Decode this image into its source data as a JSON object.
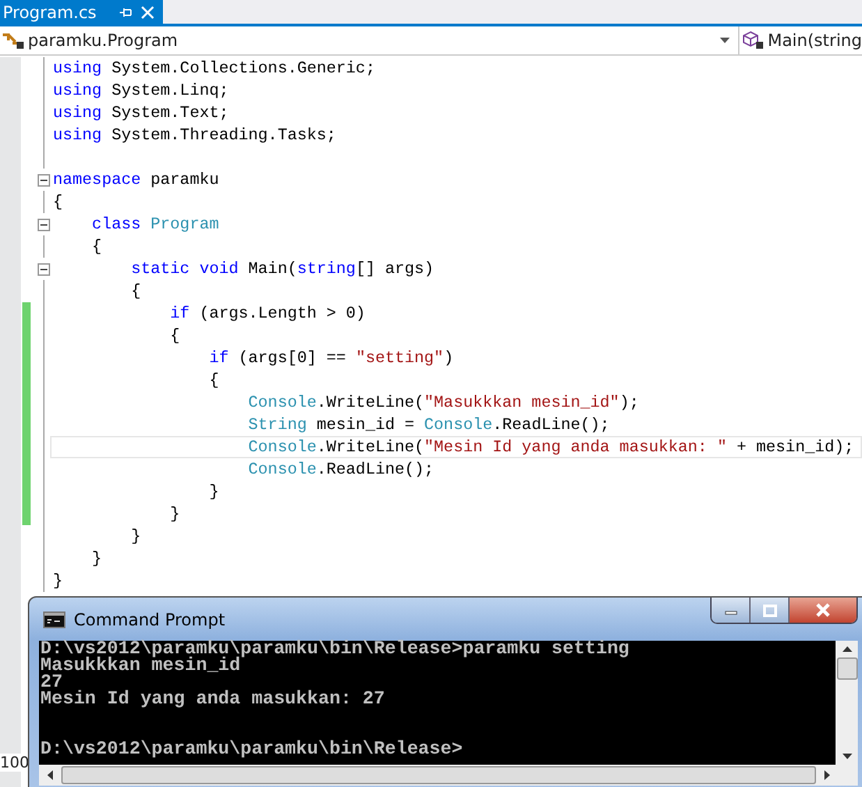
{
  "tab": {
    "title": "Program.cs",
    "selected": true
  },
  "nav": {
    "type_dropdown": "paramku.Program",
    "member_dropdown": "Main(string"
  },
  "code_lines": [
    {
      "tokens": [
        {
          "kind": "keyword",
          "text": "using"
        },
        {
          "kind": "plain",
          "text": " System.Collections.Generic;"
        }
      ],
      "foldable": false,
      "changed": false,
      "current": false
    },
    {
      "tokens": [
        {
          "kind": "keyword",
          "text": "using"
        },
        {
          "kind": "plain",
          "text": " System.Linq;"
        }
      ],
      "foldable": false,
      "changed": false,
      "current": false
    },
    {
      "tokens": [
        {
          "kind": "keyword",
          "text": "using"
        },
        {
          "kind": "plain",
          "text": " System.Text;"
        }
      ],
      "foldable": false,
      "changed": false,
      "current": false
    },
    {
      "tokens": [
        {
          "kind": "keyword",
          "text": "using"
        },
        {
          "kind": "plain",
          "text": " System.Threading.Tasks;"
        }
      ],
      "foldable": false,
      "changed": false,
      "current": false
    },
    {
      "foldable": false,
      "changed": false,
      "current": false
    },
    {
      "tokens": [
        {
          "kind": "keyword",
          "text": "namespace"
        },
        {
          "kind": "plain",
          "text": " paramku"
        }
      ],
      "foldable": true,
      "changed": false,
      "current": false
    },
    {
      "tokens": [
        {
          "kind": "plain",
          "text": "{"
        }
      ],
      "foldable": false,
      "changed": false,
      "current": false
    },
    {
      "tokens": [
        {
          "kind": "keyword",
          "text": "    class"
        },
        {
          "kind": "type",
          "text": " Program"
        }
      ],
      "foldable": true,
      "changed": false,
      "current": false
    },
    {
      "tokens": [
        {
          "kind": "plain",
          "text": "    {"
        }
      ],
      "foldable": false,
      "changed": false,
      "current": false
    },
    {
      "tokens": [
        {
          "kind": "keyword",
          "text": "        static void"
        },
        {
          "kind": "plain",
          "text": " Main("
        },
        {
          "kind": "keyword",
          "text": "string"
        },
        {
          "kind": "plain",
          "text": "[] args)"
        }
      ],
      "foldable": true,
      "changed": false,
      "current": false
    },
    {
      "tokens": [
        {
          "kind": "plain",
          "text": "        {"
        }
      ],
      "foldable": false,
      "changed": false,
      "current": false
    },
    {
      "tokens": [
        {
          "kind": "keyword",
          "text": "            if"
        },
        {
          "kind": "plain",
          "text": " (args.Length > 0)"
        }
      ],
      "foldable": false,
      "changed": true,
      "current": false
    },
    {
      "tokens": [
        {
          "kind": "plain",
          "text": "            {"
        }
      ],
      "foldable": false,
      "changed": true,
      "current": false
    },
    {
      "tokens": [
        {
          "kind": "keyword",
          "text": "                if"
        },
        {
          "kind": "plain",
          "text": " (args[0] == "
        },
        {
          "kind": "string",
          "text": "\"setting\""
        },
        {
          "kind": "plain",
          "text": ")"
        }
      ],
      "foldable": false,
      "changed": true,
      "current": false
    },
    {
      "tokens": [
        {
          "kind": "plain",
          "text": "                {"
        }
      ],
      "foldable": false,
      "changed": true,
      "current": false
    },
    {
      "tokens": [
        {
          "kind": "type",
          "text": "                    Console"
        },
        {
          "kind": "plain",
          "text": ".WriteLine("
        },
        {
          "kind": "string",
          "text": "\"Masukkkan mesin_id\""
        },
        {
          "kind": "plain",
          "text": ");"
        }
      ],
      "foldable": false,
      "changed": true,
      "current": false
    },
    {
      "tokens": [
        {
          "kind": "type",
          "text": "                    String"
        },
        {
          "kind": "plain",
          "text": " mesin_id = "
        },
        {
          "kind": "type",
          "text": "Console"
        },
        {
          "kind": "plain",
          "text": ".ReadLine();"
        }
      ],
      "foldable": false,
      "changed": true,
      "current": false
    },
    {
      "tokens": [
        {
          "kind": "type",
          "text": "                    Console"
        },
        {
          "kind": "plain",
          "text": ".WriteLine("
        },
        {
          "kind": "string",
          "text": "\"Mesin Id yang anda masukkan: \""
        },
        {
          "kind": "plain",
          "text": " + mesin_id);"
        }
      ],
      "foldable": false,
      "changed": true,
      "current": true
    },
    {
      "tokens": [
        {
          "kind": "type",
          "text": "                    Console"
        },
        {
          "kind": "plain",
          "text": ".ReadLine();"
        }
      ],
      "foldable": false,
      "changed": true,
      "current": false
    },
    {
      "tokens": [
        {
          "kind": "plain",
          "text": "                }"
        }
      ],
      "foldable": false,
      "changed": true,
      "current": false
    },
    {
      "tokens": [
        {
          "kind": "plain",
          "text": "            }"
        }
      ],
      "foldable": false,
      "changed": true,
      "current": false
    },
    {
      "tokens": [
        {
          "kind": "plain",
          "text": "        }"
        }
      ],
      "foldable": false,
      "changed": false,
      "current": false
    },
    {
      "tokens": [
        {
          "kind": "plain",
          "text": "    }"
        }
      ],
      "foldable": false,
      "changed": false,
      "current": false
    },
    {
      "tokens": [
        {
          "kind": "plain",
          "text": "}"
        }
      ],
      "foldable": false,
      "changed": false,
      "current": false
    }
  ],
  "zoom_level": "100",
  "console": {
    "title": "Command Prompt",
    "output": [
      "D:\\vs2012\\paramku\\paramku\\bin\\Release>paramku setting",
      "Masukkkan mesin_id",
      "27",
      "Mesin Id yang anda masukkan: 27"
    ],
    "prompt": "D:\\vs2012\\paramku\\paramku\\bin\\Release>"
  }
}
